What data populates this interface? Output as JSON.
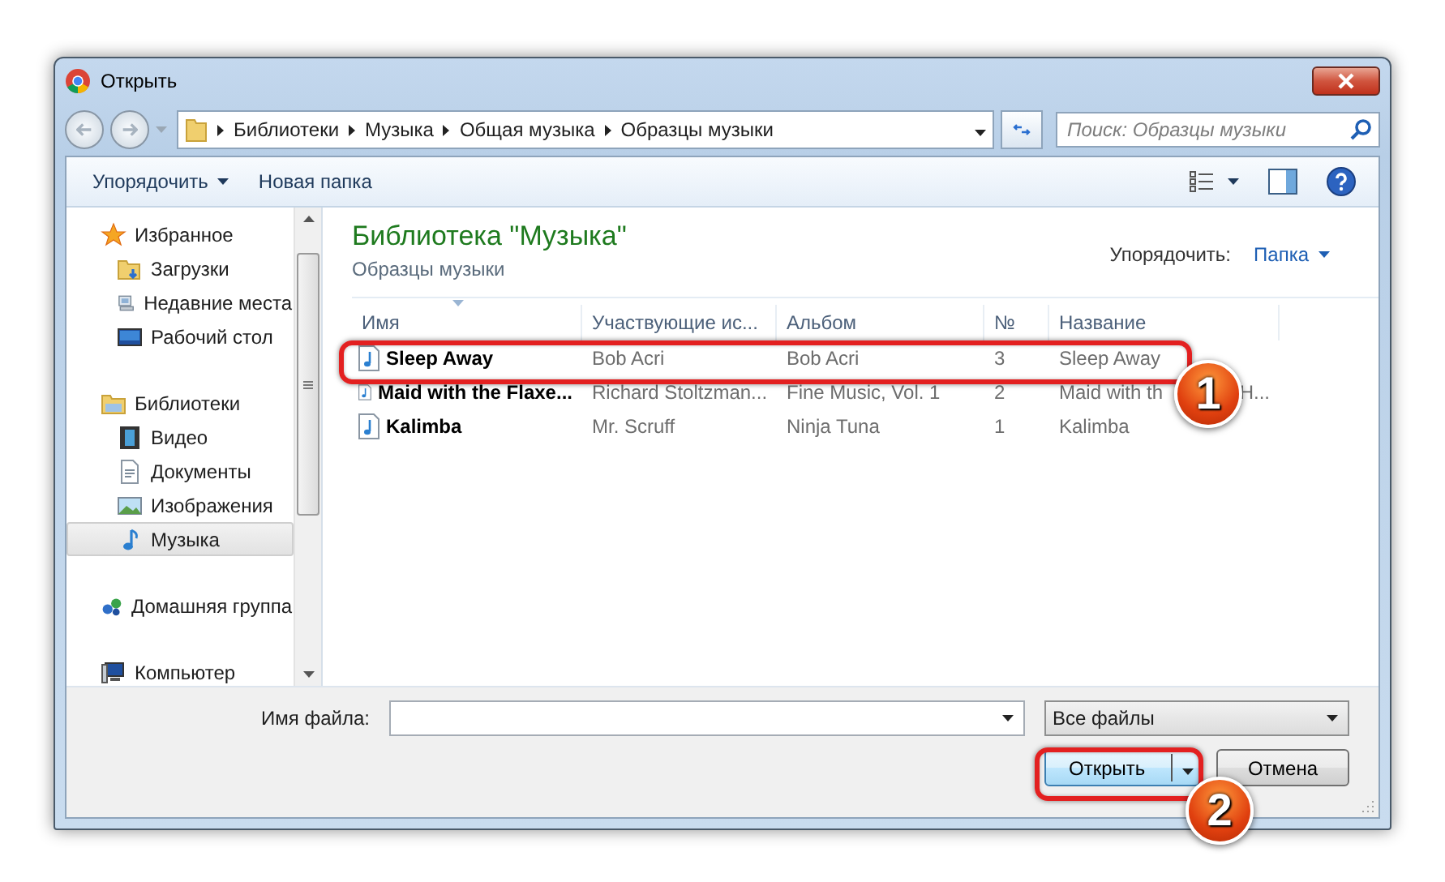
{
  "window": {
    "title": "Открыть"
  },
  "address_bar": {
    "segments": [
      "Библиотеки",
      "Музыка",
      "Общая музыка",
      "Образцы музыки"
    ]
  },
  "search": {
    "placeholder": "Поиск: Образцы музыки"
  },
  "toolbar": {
    "buttons": [
      {
        "label": "Упорядочить",
        "kind": "menu"
      },
      {
        "label": "Новая папка",
        "kind": "plain"
      }
    ]
  },
  "sidebar": {
    "items": [
      {
        "label": "Избранное",
        "selected": false,
        "children": [
          {
            "label": "Загрузки",
            "selected": false
          },
          {
            "label": "Недавние места",
            "selected": false
          },
          {
            "label": "Рабочий стол",
            "selected": false
          }
        ]
      },
      {
        "label": "Библиотеки",
        "selected": false,
        "children": [
          {
            "label": "Видео",
            "selected": false
          },
          {
            "label": "Документы",
            "selected": false
          },
          {
            "label": "Изображения",
            "selected": false
          },
          {
            "label": "Музыка",
            "selected": true
          }
        ]
      },
      {
        "label": "Домашняя группа",
        "selected": false
      },
      {
        "label": "Компьютер",
        "selected": false
      }
    ]
  },
  "library": {
    "title": "Библиотека \"Музыка\"",
    "subtitle": "Образцы музыки",
    "arrange_label": "Упорядочить:",
    "arrange_value": "Папка"
  },
  "table": {
    "columns": [
      "Имя",
      "Участвующие ис...",
      "Альбом",
      "№",
      "Название"
    ],
    "rows": [
      {
        "cells": [
          "Sleep Away",
          "Bob Acri",
          "Bob Acri",
          "3",
          "Sleep Away"
        ]
      },
      {
        "cells": [
          "Maid with the Flaxe...",
          "Richard Stoltzman...",
          "Fine Music, Vol. 1",
          "2",
          "Maid with th"
        ],
        "title_tail": "H..."
      },
      {
        "cells": [
          "Kalimba",
          "Mr. Scruff",
          "Ninja Tuna",
          "1",
          "Kalimba"
        ]
      }
    ]
  },
  "file_name": {
    "label": "Имя файла:"
  },
  "filter": {
    "value": "Все файлы"
  },
  "buttons": [
    {
      "label": "Открыть",
      "kind": "split"
    },
    {
      "label": "Отмена",
      "kind": "plain"
    }
  ],
  "annotations": [
    {
      "label": "1"
    },
    {
      "label": "2"
    }
  ]
}
